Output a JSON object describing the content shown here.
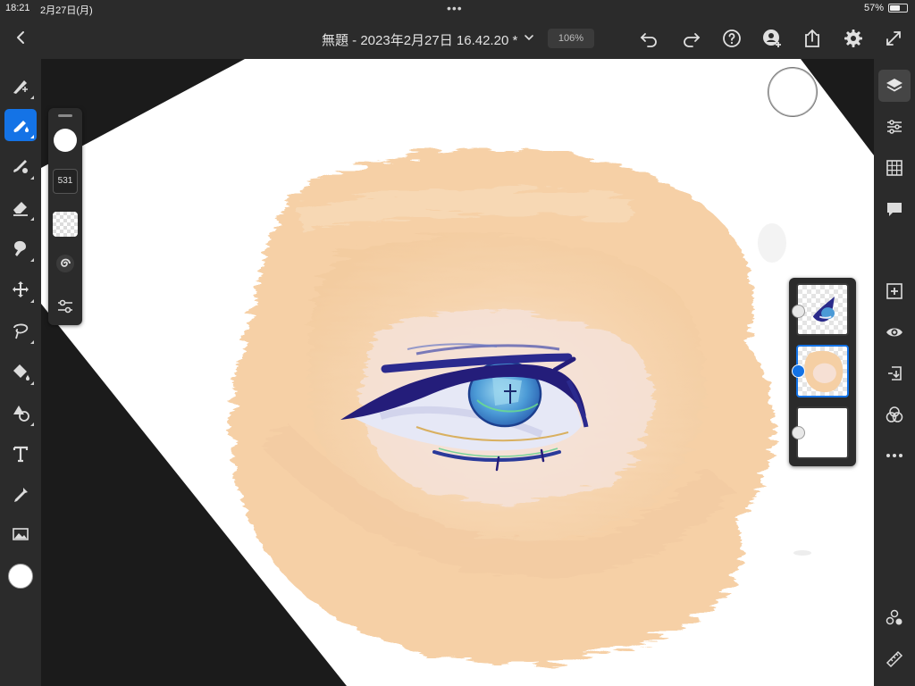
{
  "status_bar": {
    "time": "18:21",
    "date": "2月27日(月)",
    "dots": "•••",
    "battery": "57%"
  },
  "title_bar": {
    "document_title": "無題 - 2023年2月27日 16.42.20 *",
    "zoom": "106%",
    "icons": [
      "back-icon",
      "chevron-down-icon",
      "undo-icon",
      "redo-icon",
      "help-icon",
      "invite-icon",
      "share-icon",
      "settings-icon",
      "fullscreen-icon"
    ]
  },
  "left_toolbar": {
    "tools": [
      "sketch-tool",
      "paint-brush-tool",
      "mixer-brush-tool",
      "eraser-tool",
      "smudge-tool",
      "move-tool",
      "lasso-tool",
      "fill-tool",
      "shapes-tool",
      "text-tool",
      "eyedropper-tool",
      "image-tool"
    ],
    "active_tool": "paint-brush-tool",
    "foreground_color": "#ffffff"
  },
  "brush_panel": {
    "color": "#ffffff",
    "size": "531",
    "flow_icon": "swirl-icon",
    "settings_icon": "brush-settings-icon"
  },
  "right_toolbar": {
    "tools": [
      "layers-icon",
      "layer-properties-icon",
      "grid-icon",
      "comments-icon",
      "add-layer-icon",
      "visibility-icon",
      "import-icon",
      "blend-icon",
      "more-icon",
      "effects-icon",
      "ruler-icon"
    ],
    "active_tool": "layers-icon"
  },
  "layers": [
    {
      "name": "eye-layer",
      "selected": false,
      "kind": "paint"
    },
    {
      "name": "skin-layer",
      "selected": true,
      "kind": "paint"
    },
    {
      "name": "background-layer",
      "selected": false,
      "kind": "image"
    }
  ],
  "colors": {
    "accent": "#1473e6",
    "ui_dark": "#2b2b2b",
    "skin": "#f6d2a8",
    "canvas_white": "#ffffff",
    "iris_blue": "#3a7fd0",
    "eyeliner_navy": "#241d7a"
  }
}
